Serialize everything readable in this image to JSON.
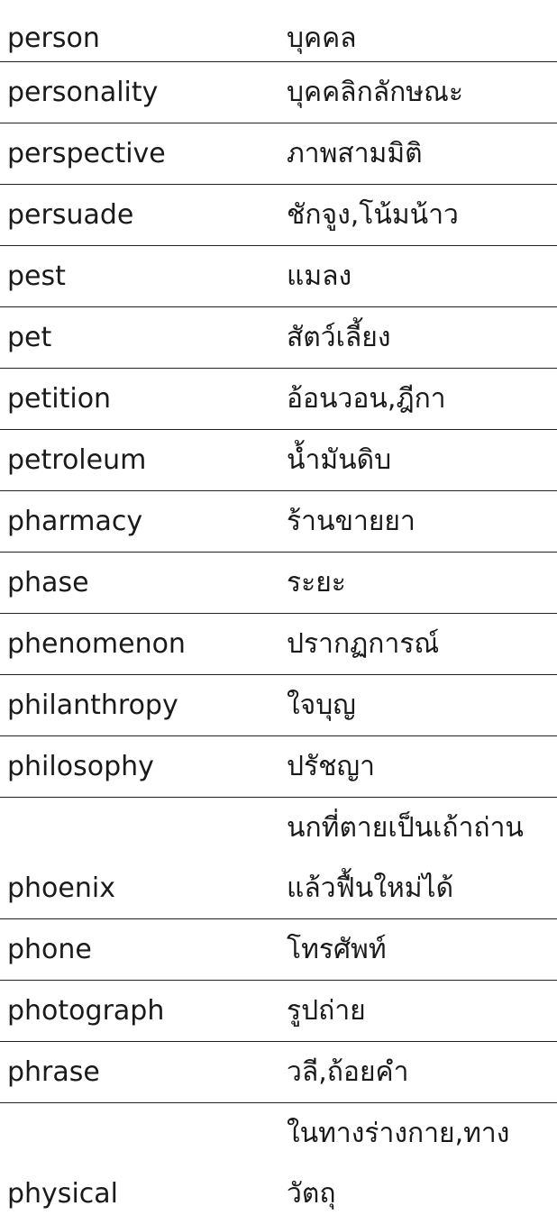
{
  "entries": [
    {
      "english": "person",
      "thai": "บุคคล"
    },
    {
      "english": "personality",
      "thai": "บุคคลิกลักษณะ"
    },
    {
      "english": "perspective",
      "thai": "ภาพสามมิติ"
    },
    {
      "english": "persuade",
      "thai": "ชักจูง,โน้มน้าว"
    },
    {
      "english": "pest",
      "thai": "แมลง"
    },
    {
      "english": "pet",
      "thai": "สัตว์เลี้ยง"
    },
    {
      "english": "petition",
      "thai": "อ้อนวอน,ฎีกา"
    },
    {
      "english": "petroleum",
      "thai": "น้ำมันดิบ"
    },
    {
      "english": "pharmacy",
      "thai": "ร้านขายยา"
    },
    {
      "english": "phase",
      "thai": "ระยะ"
    },
    {
      "english": "phenomenon",
      "thai": "ปรากฏการณ์"
    },
    {
      "english": "philanthropy",
      "thai": "ใจบุญ"
    },
    {
      "english": "philosophy",
      "thai": "ปรัชญา"
    },
    {
      "english": "phoenix",
      "thai": "นกที่ตายเป็นเถ้าถ่านแล้วฟื้นใหม่ได้"
    },
    {
      "english": "phone",
      "thai": "โทรศัพท์"
    },
    {
      "english": "photograph",
      "thai": "รูปถ่าย"
    },
    {
      "english": "phrase",
      "thai": "วลี,ถ้อยคำ"
    },
    {
      "english": "physical",
      "thai": "ในทางร่างกาย,ทางวัตถุ"
    }
  ]
}
